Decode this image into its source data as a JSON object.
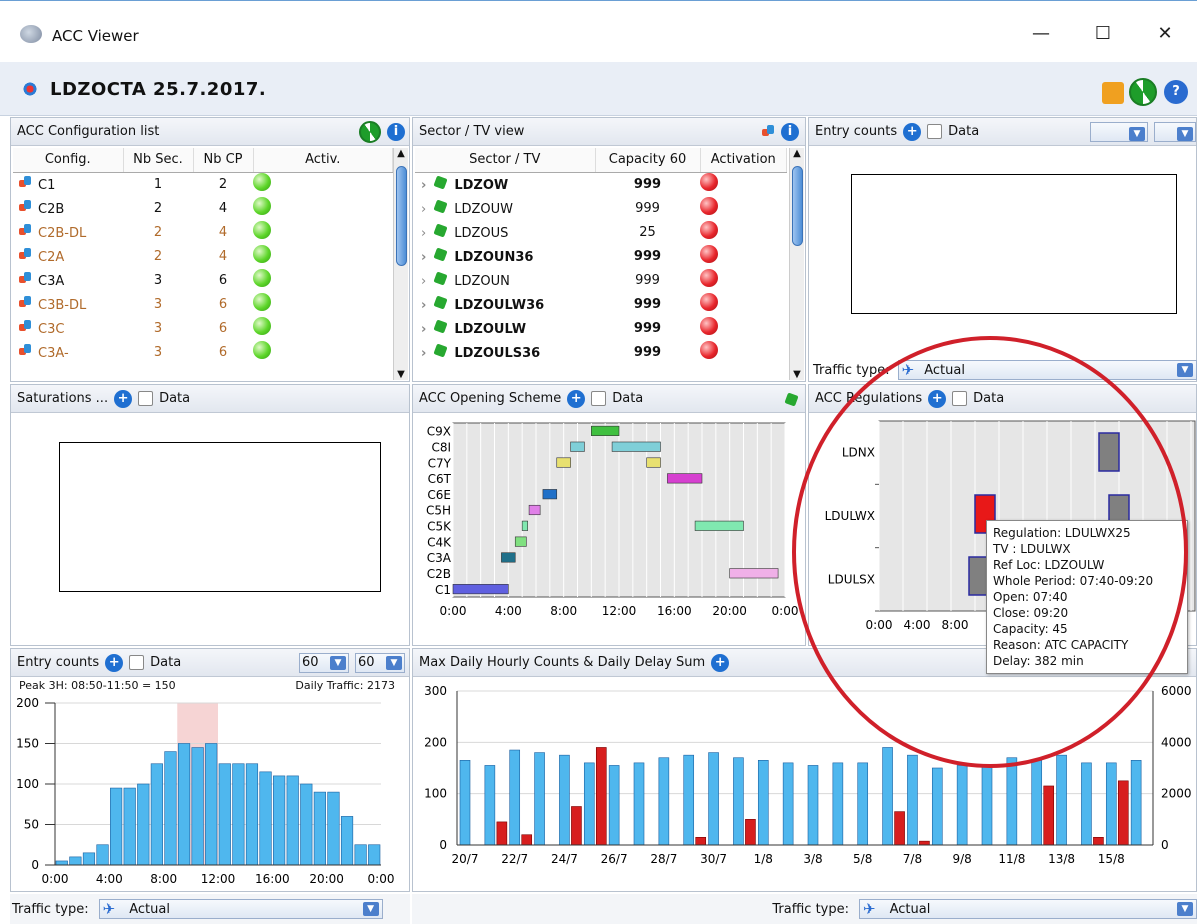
{
  "window": {
    "title": "ACC Viewer",
    "minimize": "—",
    "maximize": "☐",
    "close": "✕"
  },
  "appbar": {
    "title": "LDZOCTA  25.7.2017."
  },
  "config_panel": {
    "title": "ACC Configuration list",
    "columns": [
      "Config.",
      "Nb Sec.",
      "Nb CP",
      "Activ."
    ],
    "rows": [
      {
        "c": "C1",
        "s": "1",
        "p": "2",
        "color": "#111"
      },
      {
        "c": "C2B",
        "s": "2",
        "p": "4",
        "color": "#111"
      },
      {
        "c": "C2B-DL",
        "s": "2",
        "p": "4",
        "color": "#b06a2a"
      },
      {
        "c": "C2A",
        "s": "2",
        "p": "4",
        "color": "#b06a2a"
      },
      {
        "c": "C3A",
        "s": "3",
        "p": "6",
        "color": "#111"
      },
      {
        "c": "C3B-DL",
        "s": "3",
        "p": "6",
        "color": "#b06a2a"
      },
      {
        "c": "C3C",
        "s": "3",
        "p": "6",
        "color": "#b06a2a"
      },
      {
        "c": "C3A-",
        "s": "3",
        "p": "6",
        "color": "#b06a2a"
      }
    ]
  },
  "sector_panel": {
    "title": "Sector / TV view",
    "columns": [
      "Sector / TV",
      "Capacity 60",
      "Activation"
    ],
    "rows": [
      {
        "name": "LDZOW",
        "cap": "999",
        "bold": true
      },
      {
        "name": "LDZOUW",
        "cap": "999",
        "bold": false
      },
      {
        "name": "LDZOUS",
        "cap": "25",
        "bold": false
      },
      {
        "name": "LDZOUN36",
        "cap": "999",
        "bold": true
      },
      {
        "name": "LDZOUN",
        "cap": "999",
        "bold": false
      },
      {
        "name": "LDZOULW36",
        "cap": "999",
        "bold": true
      },
      {
        "name": "LDZOULW",
        "cap": "999",
        "bold": true
      },
      {
        "name": "LDZOULS36",
        "cap": "999",
        "bold": true
      }
    ]
  },
  "entry_top": {
    "title": "Entry counts",
    "data_label": "Data",
    "traffic_label": "Traffic type:",
    "traffic_value": "Actual"
  },
  "saturations": {
    "title": "Saturations ...",
    "data_label": "Data"
  },
  "opening": {
    "title": "ACC Opening Scheme",
    "data_label": "Data",
    "configs": [
      "C9X",
      "C8I",
      "C7Y",
      "C6T",
      "C6E",
      "C5H",
      "C5K",
      "C4K",
      "C3A",
      "C2B",
      "C1"
    ],
    "xticks": [
      "0:00",
      "4:00",
      "8:00",
      "12:00",
      "16:00",
      "20:00",
      "0:00"
    ]
  },
  "regulations": {
    "title": "ACC Regulations",
    "data_label": "Data",
    "tvs": [
      "LDNX",
      "LDULWX",
      "LDULSX"
    ],
    "xticks": [
      "0:00",
      "4:00",
      "8:00"
    ],
    "tooltip": [
      "Regulation: LDULWX25",
      "TV : LDULWX",
      "Ref Loc: LDZOULW",
      "Whole Period: 07:40-09:20",
      "Open: 07:40",
      "Close: 09:20",
      "Capacity: 45",
      "Reason: ATC CAPACITY",
      "Delay: 382 min"
    ]
  },
  "entry_bottom": {
    "title": "Entry counts",
    "data_label": "Data",
    "dd1": "60",
    "dd2": "60",
    "peak": "Peak 3H: 08:50-11:50 = 150",
    "daily": "Daily Traffic: 2173",
    "traffic_label": "Traffic type:",
    "traffic_value": "Actual"
  },
  "maxdaily": {
    "title": "Max Daily Hourly Counts & Daily Delay Sum",
    "traffic_label": "Traffic type:",
    "traffic_value": "Actual"
  },
  "chart_data": [
    {
      "type": "bar",
      "title": "Entry counts",
      "x": [
        "0:00",
        "1:00",
        "2:00",
        "3:00",
        "4:00",
        "5:00",
        "6:00",
        "7:00",
        "8:00",
        "9:00",
        "10:00",
        "11:00",
        "12:00",
        "13:00",
        "14:00",
        "15:00",
        "16:00",
        "17:00",
        "18:00",
        "19:00",
        "20:00",
        "21:00",
        "22:00",
        "23:00"
      ],
      "values": [
        5,
        10,
        15,
        25,
        95,
        95,
        100,
        125,
        140,
        150,
        145,
        150,
        125,
        125,
        125,
        115,
        110,
        110,
        100,
        90,
        90,
        60,
        25,
        25
      ],
      "xticks": [
        "0:00",
        "4:00",
        "8:00",
        "12:00",
        "16:00",
        "20:00",
        "0:00"
      ],
      "ylim": [
        0,
        200
      ],
      "yticks": [
        0,
        50,
        100,
        150,
        200
      ],
      "highlight": [
        9,
        12
      ],
      "color": "#4fb7ee"
    },
    {
      "type": "bar",
      "title": "Max Daily Hourly Counts & Daily Delay Sum",
      "categories": [
        "20/7",
        "21/7",
        "22/7",
        "23/7",
        "24/7",
        "25/7",
        "26/7",
        "27/7",
        "28/7",
        "29/7",
        "30/7",
        "31/7",
        "1/8",
        "2/8",
        "3/8",
        "4/8",
        "5/8",
        "6/8",
        "7/8",
        "8/8",
        "9/8",
        "10/8",
        "11/8",
        "12/8",
        "13/8",
        "14/8",
        "15/8",
        "16/8"
      ],
      "xticks": [
        "20/7",
        "22/7",
        "24/7",
        "26/7",
        "28/7",
        "30/7",
        "1/8",
        "3/8",
        "5/8",
        "7/8",
        "9/8",
        "11/8",
        "13/8",
        "15/8"
      ],
      "series": [
        {
          "name": "",
          "axis": "left",
          "color": "#4fb7ee",
          "values": [
            165,
            155,
            185,
            180,
            175,
            160,
            155,
            160,
            170,
            175,
            180,
            170,
            165,
            160,
            155,
            160,
            160,
            190,
            175,
            150,
            155,
            155,
            170,
            165,
            175,
            160,
            160,
            165
          ]
        },
        {
          "name": "",
          "axis": "right",
          "color": "#d71e1e",
          "values": [
            0,
            0,
            900,
            400,
            0,
            1500,
            3800,
            0,
            0,
            0,
            300,
            0,
            1000,
            0,
            0,
            0,
            0,
            0,
            1300,
            150,
            0,
            0,
            0,
            0,
            2300,
            0,
            300,
            2500
          ]
        }
      ],
      "ylim": [
        0,
        300
      ],
      "yticks": [
        0,
        100,
        200,
        300
      ],
      "y2lim": [
        0,
        6000
      ],
      "y2ticks": [
        0,
        2000,
        4000,
        6000
      ]
    }
  ]
}
